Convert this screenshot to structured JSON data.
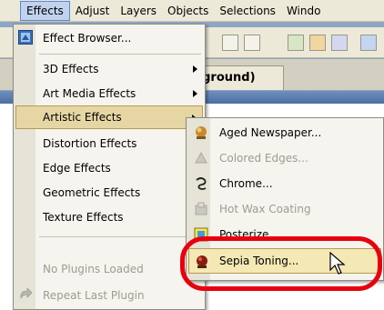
{
  "menubar": {
    "items": [
      {
        "label": "Effects",
        "active": true
      },
      {
        "label": "Adjust"
      },
      {
        "label": "Layers"
      },
      {
        "label": "Objects"
      },
      {
        "label": "Selections"
      },
      {
        "label": "Windo"
      }
    ]
  },
  "document": {
    "tab_label": "ackground)"
  },
  "effects_menu": {
    "items": [
      {
        "label": "Effect Browser...",
        "icon": "effect-browser-icon"
      },
      {
        "label": "3D Effects",
        "submenu": true
      },
      {
        "label": "Art Media Effects",
        "submenu": true
      },
      {
        "label": "Artistic Effects",
        "submenu": true,
        "highlighted": true
      },
      {
        "label": "Distortion Effects",
        "submenu": true
      },
      {
        "label": "Edge Effects",
        "submenu": true
      },
      {
        "label": "Geometric Effects",
        "submenu": true
      },
      {
        "label": "Texture Effects",
        "submenu": true
      },
      {
        "label": "No Plugins Loaded",
        "disabled": true
      },
      {
        "label": "Repeat Last Plugin",
        "disabled": true,
        "icon": "repeat-plugin-icon"
      }
    ]
  },
  "artistic_submenu": {
    "items": [
      {
        "label": "Aged Newspaper...",
        "icon": "aged-newspaper-icon"
      },
      {
        "label": "Colored Edges...",
        "icon": "colored-edges-icon",
        "disabled": true
      },
      {
        "label": "Chrome...",
        "icon": "chrome-icon"
      },
      {
        "label": "Hot Wax Coating",
        "icon": "hot-wax-icon",
        "disabled": true
      },
      {
        "label": "Posterize...",
        "icon": "posterize-icon"
      },
      {
        "label": "Sepia Toning...",
        "icon": "sepia-toning-icon",
        "highlighted": true
      }
    ]
  },
  "colors": {
    "menubar": "#ece9d8",
    "menu_highlight": "#e6d6a4",
    "annotation": "#e8000d"
  }
}
